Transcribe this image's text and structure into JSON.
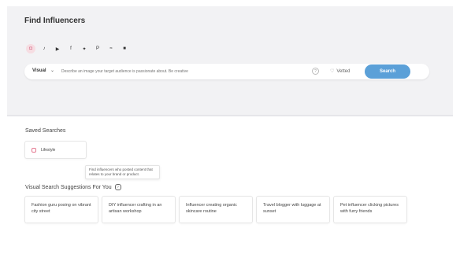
{
  "title": "Find Influencers",
  "platforms": [
    {
      "icon": "instagram-icon",
      "glyph": "◘",
      "active": true
    },
    {
      "icon": "tiktok-icon",
      "glyph": "♪",
      "active": false
    },
    {
      "icon": "youtube-icon",
      "glyph": "▶",
      "active": false
    },
    {
      "icon": "facebook-icon",
      "glyph": "f",
      "active": false
    },
    {
      "icon": "twitter-icon",
      "glyph": "✦",
      "active": false
    },
    {
      "icon": "pinterest-icon",
      "glyph": "P",
      "active": false
    },
    {
      "icon": "rss-icon",
      "glyph": "≈",
      "active": false
    },
    {
      "icon": "linkedin-icon",
      "glyph": "■",
      "active": false
    }
  ],
  "search": {
    "mode": "Visual",
    "placeholder": "Describe an image your target audience is passionate about. Be creative",
    "vetted_label": "Vetted",
    "button_label": "Search"
  },
  "saved": {
    "heading": "Saved Searches",
    "items": [
      "Lifestyle"
    ]
  },
  "tooltip": "Find influencers who posted content that relates to your brand or product.",
  "suggestions": {
    "heading": "Visual Search Suggestions For You",
    "items": [
      "Fashion guru posing on vibrant city street",
      "DIY influencer crafting in an artisan workshop",
      "Influencer creating organic skincare routine",
      "Travel blogger with luggage at sunset",
      "Pet influencer clicking pictures with furry friends"
    ]
  },
  "colors": {
    "accent": "#5ba0d8",
    "instagram": "#d15a7a"
  }
}
